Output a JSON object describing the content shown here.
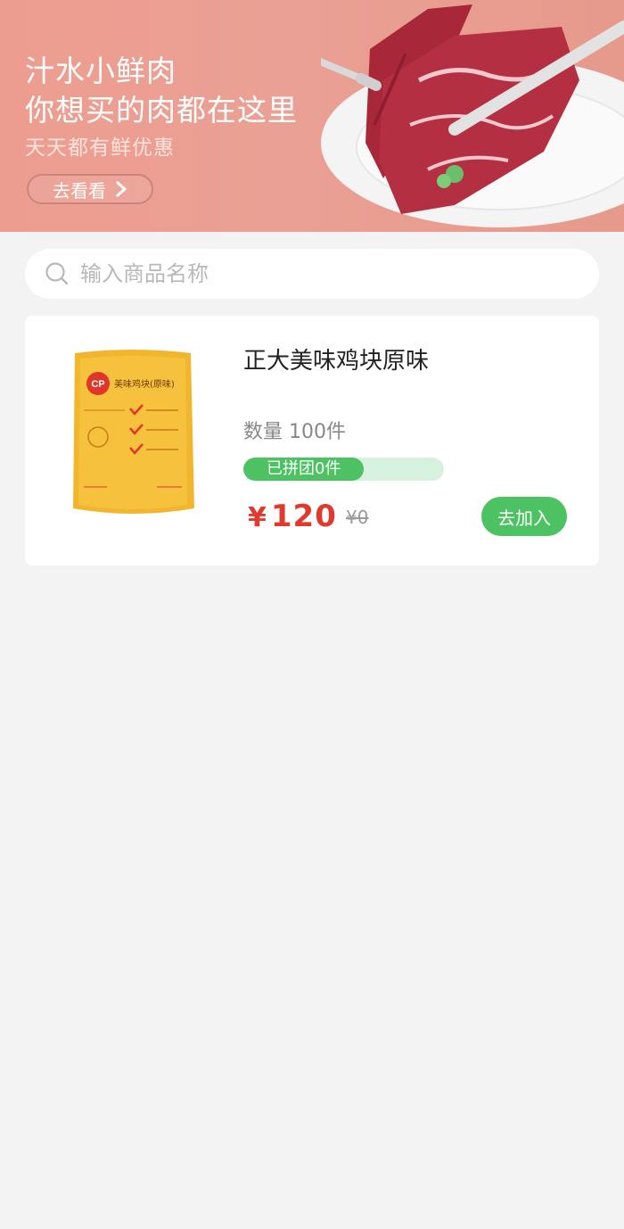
{
  "banner": {
    "title_line1": "汁水小鲜肉",
    "title_line2": "你想买的肉都在这里",
    "subtitle": "天天都有鲜优惠",
    "button_label": "去看看",
    "button_icon": "chevron-right-icon"
  },
  "search": {
    "placeholder": "输入商品名称",
    "value": "",
    "icon": "search-icon"
  },
  "products": [
    {
      "name": "正大美味鸡块原味",
      "quantity_text": "数量 100件",
      "group_text": "已拼团0件",
      "price_symbol": "¥",
      "price": "120",
      "original_price": "¥0",
      "add_label": "去加入",
      "package_text": "美味鸡块(原味)",
      "package_brand": "CP"
    }
  ],
  "colors": {
    "banner_bg": "#eba095",
    "accent_green": "#4cc263",
    "progress_track": "#d6f1dd",
    "price_red": "#e03a2e",
    "page_bg": "#f3f3f3"
  }
}
